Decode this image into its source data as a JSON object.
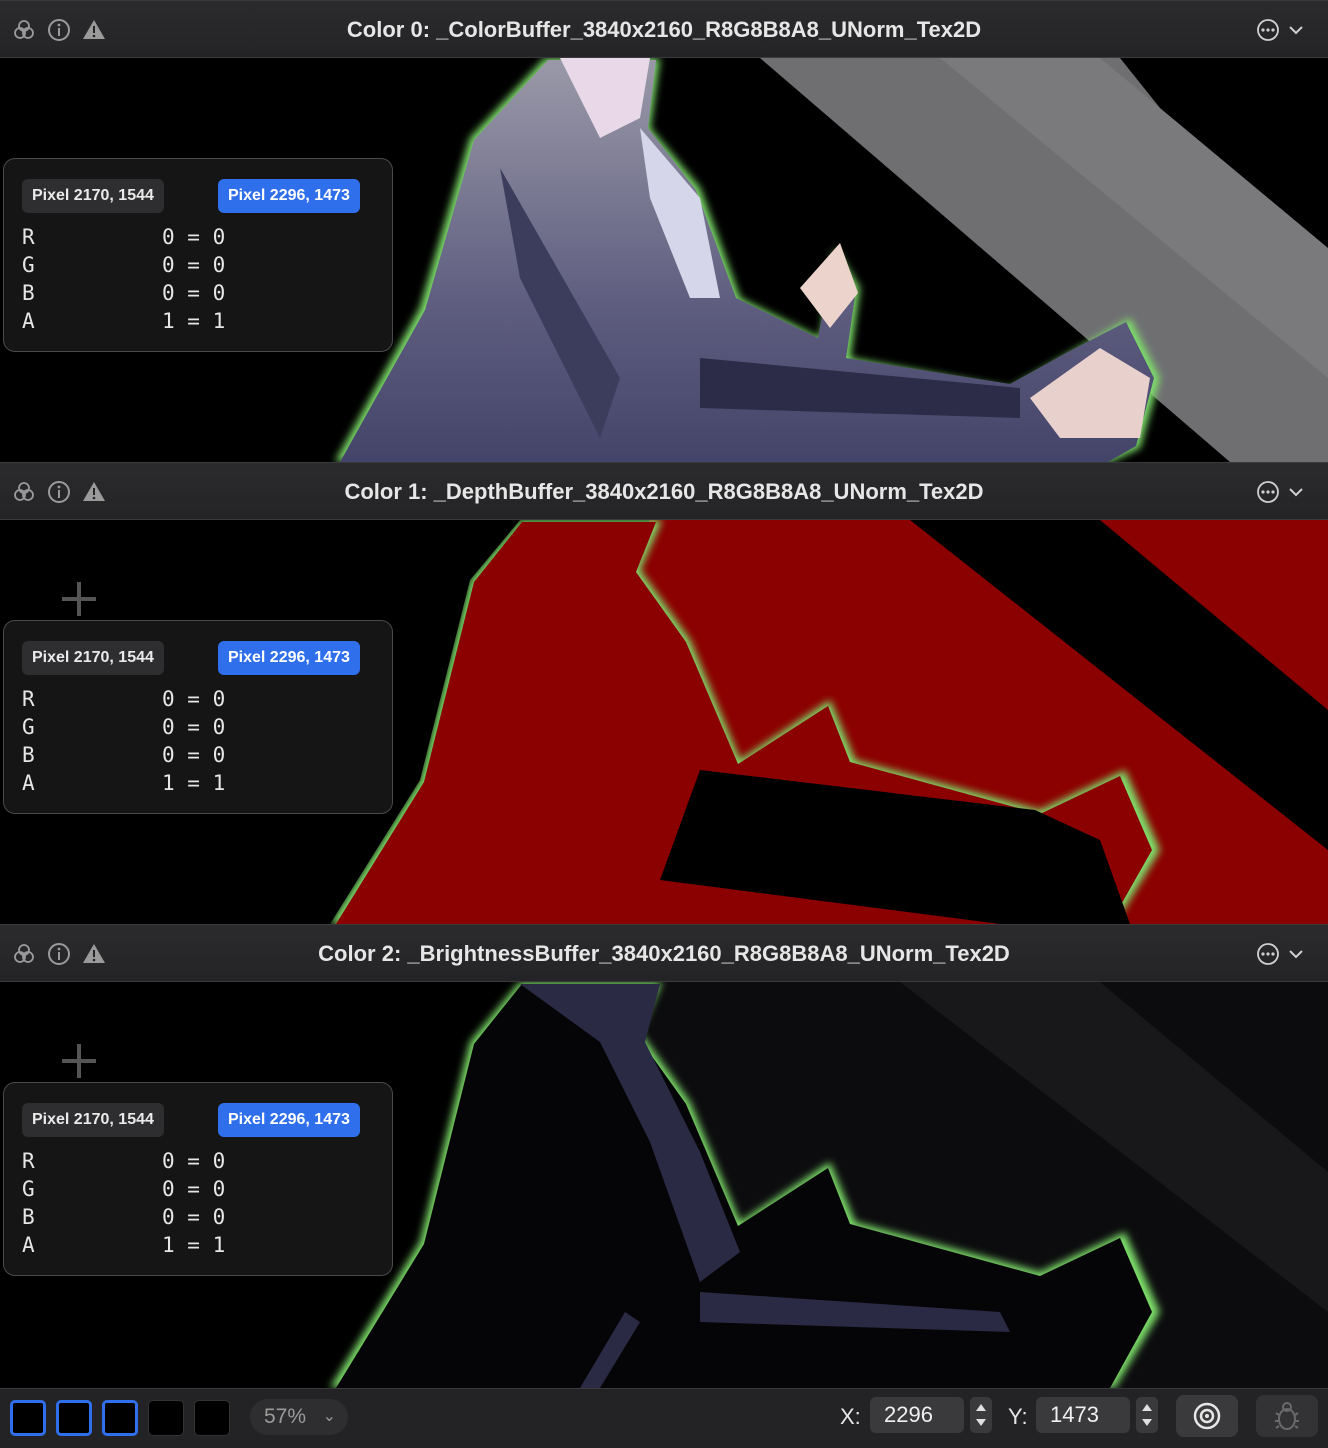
{
  "panels": [
    {
      "title": "Color 0: _ColorBuffer_3840x2160_R8G8B8A8_UNorm_Tex2D",
      "pixel_a": "Pixel 2170, 1544",
      "pixel_b": "Pixel 2296, 1473",
      "rows": [
        {
          "ch": "R",
          "val": "0 = 0"
        },
        {
          "ch": "G",
          "val": "0 = 0"
        },
        {
          "ch": "B",
          "val": "0 = 0"
        },
        {
          "ch": "A",
          "val": "1 = 1"
        }
      ]
    },
    {
      "title": "Color 1: _DepthBuffer_3840x2160_R8G8B8A8_UNorm_Tex2D",
      "pixel_a": "Pixel 2170, 1544",
      "pixel_b": "Pixel 2296, 1473",
      "rows": [
        {
          "ch": "R",
          "val": "0 = 0"
        },
        {
          "ch": "G",
          "val": "0 = 0"
        },
        {
          "ch": "B",
          "val": "0 = 0"
        },
        {
          "ch": "A",
          "val": "1 = 1"
        }
      ]
    },
    {
      "title": "Color 2: _BrightnessBuffer_3840x2160_R8G8B8A8_UNorm_Tex2D",
      "pixel_a": "Pixel 2170, 1544",
      "pixel_b": "Pixel 2296, 1473",
      "rows": [
        {
          "ch": "R",
          "val": "0 = 0"
        },
        {
          "ch": "G",
          "val": "0 = 0"
        },
        {
          "ch": "B",
          "val": "0 = 0"
        },
        {
          "ch": "A",
          "val": "1 = 1"
        }
      ]
    }
  ],
  "footer": {
    "zoom": "57%",
    "x_label": "X:",
    "x_value": "2296",
    "y_label": "Y:",
    "y_value": "1473"
  },
  "colors": {
    "accent": "#2f6fec",
    "outline": "#7ee06a",
    "depth_red": "#8b0000",
    "silhouette": "#2a2a44"
  }
}
